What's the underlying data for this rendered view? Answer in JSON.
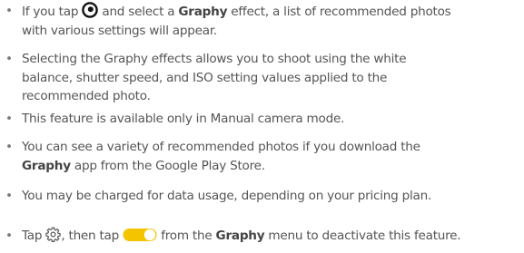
{
  "bullet_char": "•",
  "items": [
    {
      "l1_pre": "If you tap",
      "l1_icon": "capture-circle-icon",
      "l1_mid": "and select a",
      "l1_bold": "Graphy",
      "l1_post": "effect, a list of recommended photos",
      "l2": "with various settings will appear."
    },
    {
      "l1": "Selecting the Graphy effects allows you to shoot using the white",
      "l2": "balance, shutter speed, and ISO setting values applied to the",
      "l3": "recommended photo."
    },
    {
      "l1": "This feature is available only in Manual camera mode."
    },
    {
      "l1": "You can see a variety of recommended photos if you download the",
      "l2_bold": "Graphy",
      "l2_post": "app from the Google Play Store."
    },
    {
      "l1": "You may be charged for data usage, depending on your pricing plan."
    },
    {
      "pre": "Tap",
      "icon1": "gear-icon",
      "mid": ", then tap",
      "icon2": "toggle-switch-icon",
      "mid2": "from the",
      "bold": "Graphy",
      "post": "menu to deactivate this feature."
    }
  ],
  "colors": {
    "text": "#555555",
    "bold": "#444444",
    "toggle_on": "#f5c400",
    "icon": "#111111"
  }
}
